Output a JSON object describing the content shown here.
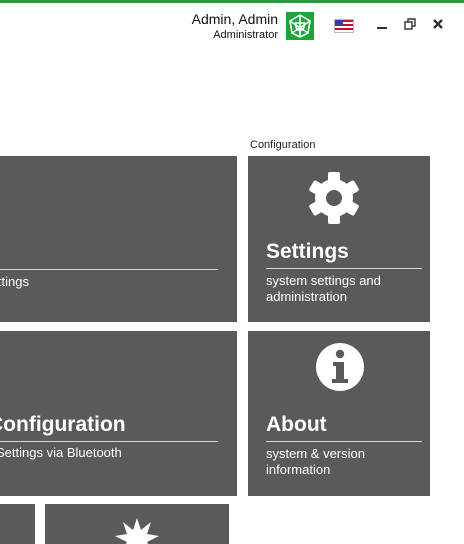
{
  "header": {
    "user_name": "Admin, Admin",
    "user_role": "Administrator",
    "accent_color": "#2f9a3a",
    "logo_color": "#1ea43b",
    "language_icon": "us-flag-icon",
    "window_controls": [
      "minimize-icon",
      "restore-icon",
      "close-icon"
    ]
  },
  "section": {
    "label": "Configuration"
  },
  "tiles": {
    "left_top": {
      "desc": "Settings"
    },
    "settings": {
      "icon": "gear-icon",
      "title": "Settings",
      "desc": "system settings and administration"
    },
    "left_mid": {
      "title": "Configuration",
      "desc": "Settings via Bluetooth"
    },
    "about": {
      "icon": "info-icon",
      "title": "About",
      "desc": "system & version information"
    },
    "bottom_mid": {
      "icon": "starburst-icon"
    }
  },
  "colors": {
    "tile_bg": "#5a5a5a",
    "tile_text": "#ffffff"
  }
}
